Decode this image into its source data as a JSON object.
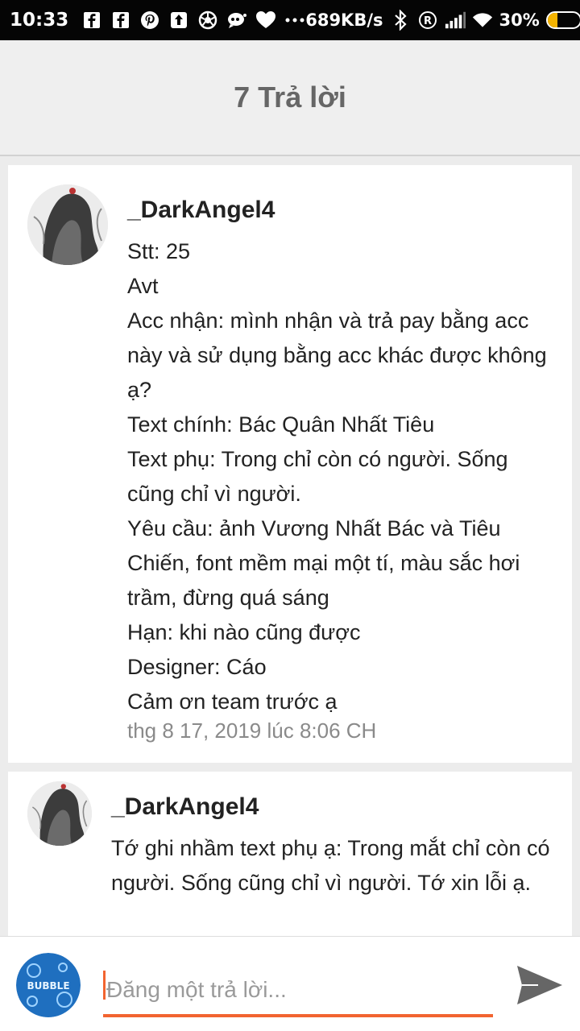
{
  "status_bar": {
    "time": "10:33",
    "network_speed": "689KB/s",
    "battery_percent": "30%",
    "battery_level": 0.3,
    "colors": {
      "background": "#050505",
      "battery": "#f5b400"
    },
    "icons": [
      "facebook-icon",
      "facebook-icon",
      "pinterest-icon",
      "upload-icon",
      "aperture-icon",
      "messenger-icon",
      "heart-icon",
      "more-icon",
      "bluetooth-icon",
      "registered-icon",
      "signal-icon",
      "wifi-icon",
      "battery-icon"
    ]
  },
  "header": {
    "title": "7 Trả lời"
  },
  "replies": [
    {
      "author": "_DarkAngel4",
      "text": "Stt: 25\nAvt\nAcc nhận: mình nhận và trả pay bằng acc này và sử dụng bằng acc khác được không ạ?\nText chính: Bác Quân Nhất Tiêu\nText phụ: Trong chỉ còn có người. Sống cũng chỉ vì người.\nYêu cầu: ảnh Vương Nhất Bác và Tiêu Chiến, font mềm mại một tí, màu sắc hơi trầm, đừng quá sáng\nHạn: khi nào cũng được\nDesigner: Cáo\nCảm ơn team trước ạ",
      "timestamp": "thg 8 17, 2019 lúc 8:06 CH"
    },
    {
      "author": "_DarkAngel4",
      "text": "Tớ ghi nhầm text phụ ạ: Trong mắt chỉ còn có người. Sống cũng chỉ vì người. Tớ xin lỗi ạ."
    }
  ],
  "composer": {
    "placeholder": "Đăng một trả lời...",
    "value": "",
    "accent_color": "#f26430",
    "my_avatar_text": "BUBBLE"
  }
}
